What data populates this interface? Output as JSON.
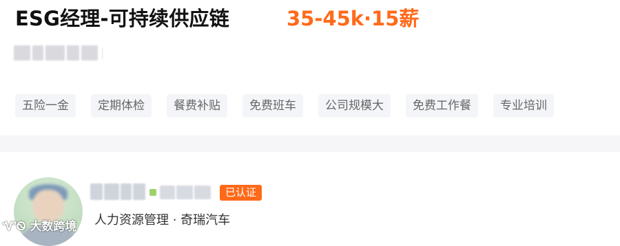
{
  "job": {
    "title": "ESG经理-可持续供应链",
    "salary": "35-45k·15薪"
  },
  "benefits": [
    "五险一金",
    "定期体检",
    "餐费补贴",
    "免费班车",
    "公司规模大",
    "免费工作餐",
    "专业培训"
  ],
  "recruiter": {
    "verified_badge": "已认证",
    "role_company": "人力资源管理 · 奇瑞汽车"
  },
  "watermark": "大数跨境",
  "colors": {
    "accent": "#ff6a1a",
    "tag_bg": "#f4f5f8",
    "online": "#9bd36b"
  }
}
